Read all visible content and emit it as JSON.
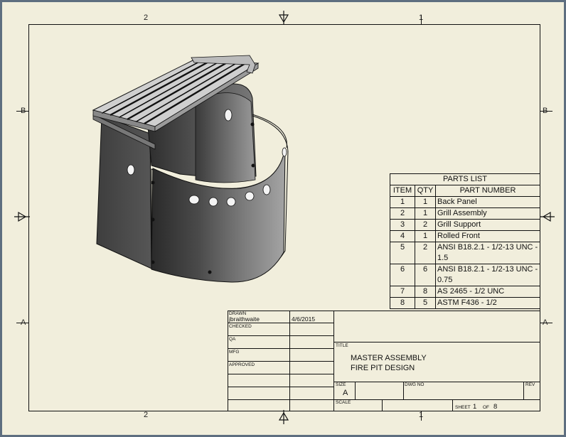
{
  "zones": {
    "top_left": "2",
    "top_right": "1",
    "bottom_left": "2",
    "bottom_right": "1",
    "left_upper": "B",
    "left_lower": "A",
    "right_upper": "B",
    "right_lower": "A"
  },
  "parts_list": {
    "title": "PARTS LIST",
    "headers": [
      "ITEM",
      "QTY",
      "PART NUMBER"
    ],
    "rows": [
      {
        "item": "1",
        "qty": "1",
        "part": "Back Panel"
      },
      {
        "item": "2",
        "qty": "1",
        "part": "Grill Assembly"
      },
      {
        "item": "3",
        "qty": "2",
        "part": "Grill Support"
      },
      {
        "item": "4",
        "qty": "1",
        "part": "Rolled Front"
      },
      {
        "item": "5",
        "qty": "2",
        "part": "ANSI B18.2.1 - 1/2-13 UNC - 1.5"
      },
      {
        "item": "6",
        "qty": "6",
        "part": "ANSI B18.2.1 - 1/2-13 UNC - 0.75"
      },
      {
        "item": "7",
        "qty": "8",
        "part": "AS 2465 - 1/2  UNC"
      },
      {
        "item": "8",
        "qty": "5",
        "part": "ASTM F436 - 1/2"
      }
    ]
  },
  "title_block": {
    "drawn_label": "DRAWN",
    "drawn_by": "jbraithwaite",
    "drawn_date": "4/6/2015",
    "checked_label": "CHECKED",
    "qa_label": "QA",
    "mfg_label": "MFG",
    "approved_label": "APPROVED",
    "title_label": "TITLE",
    "title_line1": "MASTER ASSEMBLY",
    "title_line2": "FIRE PIT DESIGN",
    "size_label": "SIZE",
    "size": "A",
    "dwg_no_label": "DWG NO",
    "rev_label": "REV",
    "scale_label": "SCALE",
    "sheet_label": "SHEET",
    "sheet_num": "1",
    "sheet_of": "OF",
    "sheet_total": "8"
  },
  "colors": {
    "background": "#5e6e80",
    "sheet": "#f1eedc",
    "line": "#111111",
    "metal_dark": "#3a3a3a",
    "metal_light": "#9a9a9a"
  }
}
